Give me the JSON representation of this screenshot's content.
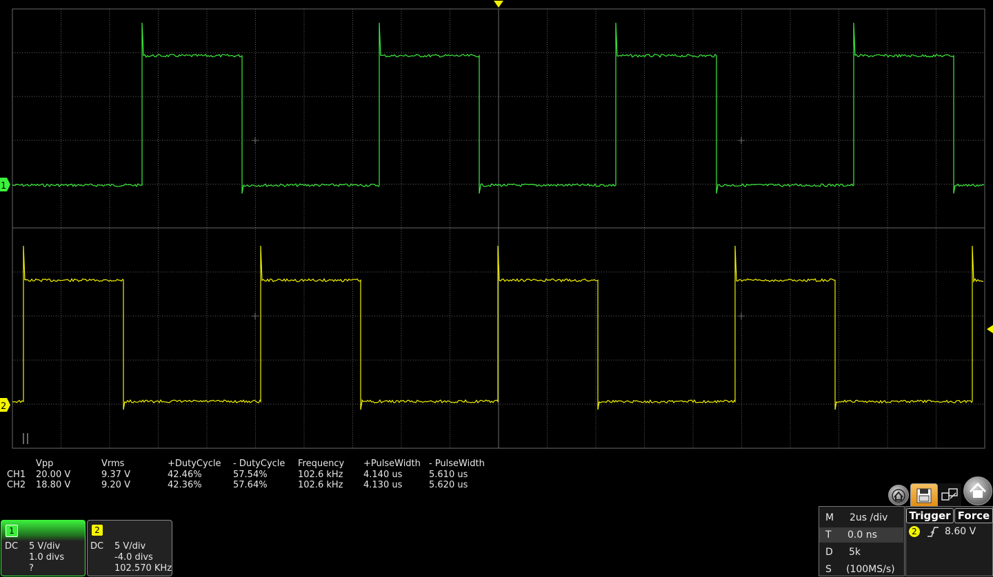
{
  "colors": {
    "ch1": "#3cf03c",
    "ch2": "#f4f400",
    "grid": "#6a6a6a",
    "background": "#000000"
  },
  "trace_markers": {
    "ch1": "1",
    "ch2": "2"
  },
  "measurements": {
    "headers": [
      "Vpp",
      "Vrms",
      "+DutyCycle",
      "- DutyCycle",
      "Frequency",
      "+PulseWidth",
      "- PulseWidth"
    ],
    "rows": [
      {
        "label": "CH1",
        "values": [
          "20.00 V",
          "9.37 V",
          "42.46%",
          "57.54%",
          "102.6 kHz",
          "4.140 us",
          "5.610 us"
        ]
      },
      {
        "label": "CH2",
        "values": [
          "18.80 V",
          "9.20 V",
          "42.36%",
          "57.64%",
          "102.6 kHz",
          "4.130 us",
          "5.620 us"
        ]
      }
    ]
  },
  "channels": [
    {
      "id": "1",
      "coupling": "DC",
      "scale": "5 V/div",
      "offset": "1.0 divs",
      "extra": "?"
    },
    {
      "id": "2",
      "coupling": "DC",
      "scale": "5 V/div",
      "offset": "-4.0 divs",
      "extra": "102.570 KHz"
    }
  ],
  "horizontal": {
    "m_label": "M",
    "m_value": "2us /div",
    "t_label": "T",
    "t_value": "0.0 ns",
    "d_label": "D",
    "d_value": "5k",
    "s_label": "S",
    "s_value": "(100MS/s)"
  },
  "trigger": {
    "trigger_label": "Trigger",
    "force_label": "Force",
    "source": "2",
    "level": "8.60 V"
  },
  "toolbar_icons": [
    "home-history-icon",
    "save-icon",
    "display-layout-icon",
    "home-icon"
  ]
}
